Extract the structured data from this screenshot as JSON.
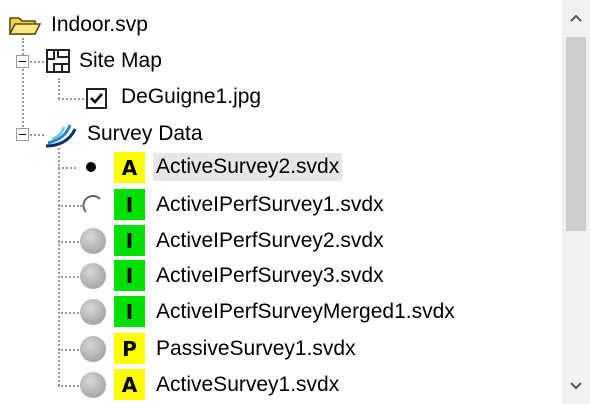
{
  "tree": {
    "root": {
      "label": "Indoor.svp",
      "icon": "folder-icon"
    },
    "site_map": {
      "label": "Site Map",
      "icon": "floorplan-icon",
      "children": [
        {
          "label": "DeGuigne1.jpg",
          "checked": true
        }
      ]
    },
    "survey_data": {
      "label": "Survey Data",
      "icon": "survey-wave-icon",
      "items": [
        {
          "label": "ActiveSurvey2.svdx",
          "badge": "A",
          "badge_color": "#ffff00",
          "state": "selected"
        },
        {
          "label": "ActiveIPerfSurvey1.svdx",
          "badge": "I",
          "badge_color": "#00e000",
          "state": "unselected"
        },
        {
          "label": "ActiveIPerfSurvey2.svdx",
          "badge": "I",
          "badge_color": "#00e000",
          "state": "disabled"
        },
        {
          "label": "ActiveIPerfSurvey3.svdx",
          "badge": "I",
          "badge_color": "#00e000",
          "state": "disabled"
        },
        {
          "label": "ActiveIPerfSurveyMerged1.svdx",
          "badge": "I",
          "badge_color": "#00e000",
          "state": "disabled"
        },
        {
          "label": "PassiveSurvey1.svdx",
          "badge": "P",
          "badge_color": "#ffff00",
          "state": "disabled"
        },
        {
          "label": "ActiveSurvey1.svdx",
          "badge": "A",
          "badge_color": "#ffff00",
          "state": "disabled"
        }
      ]
    }
  },
  "scrollbar": {
    "up_icon": "chevron-up-icon",
    "down_icon": "chevron-down-icon"
  }
}
